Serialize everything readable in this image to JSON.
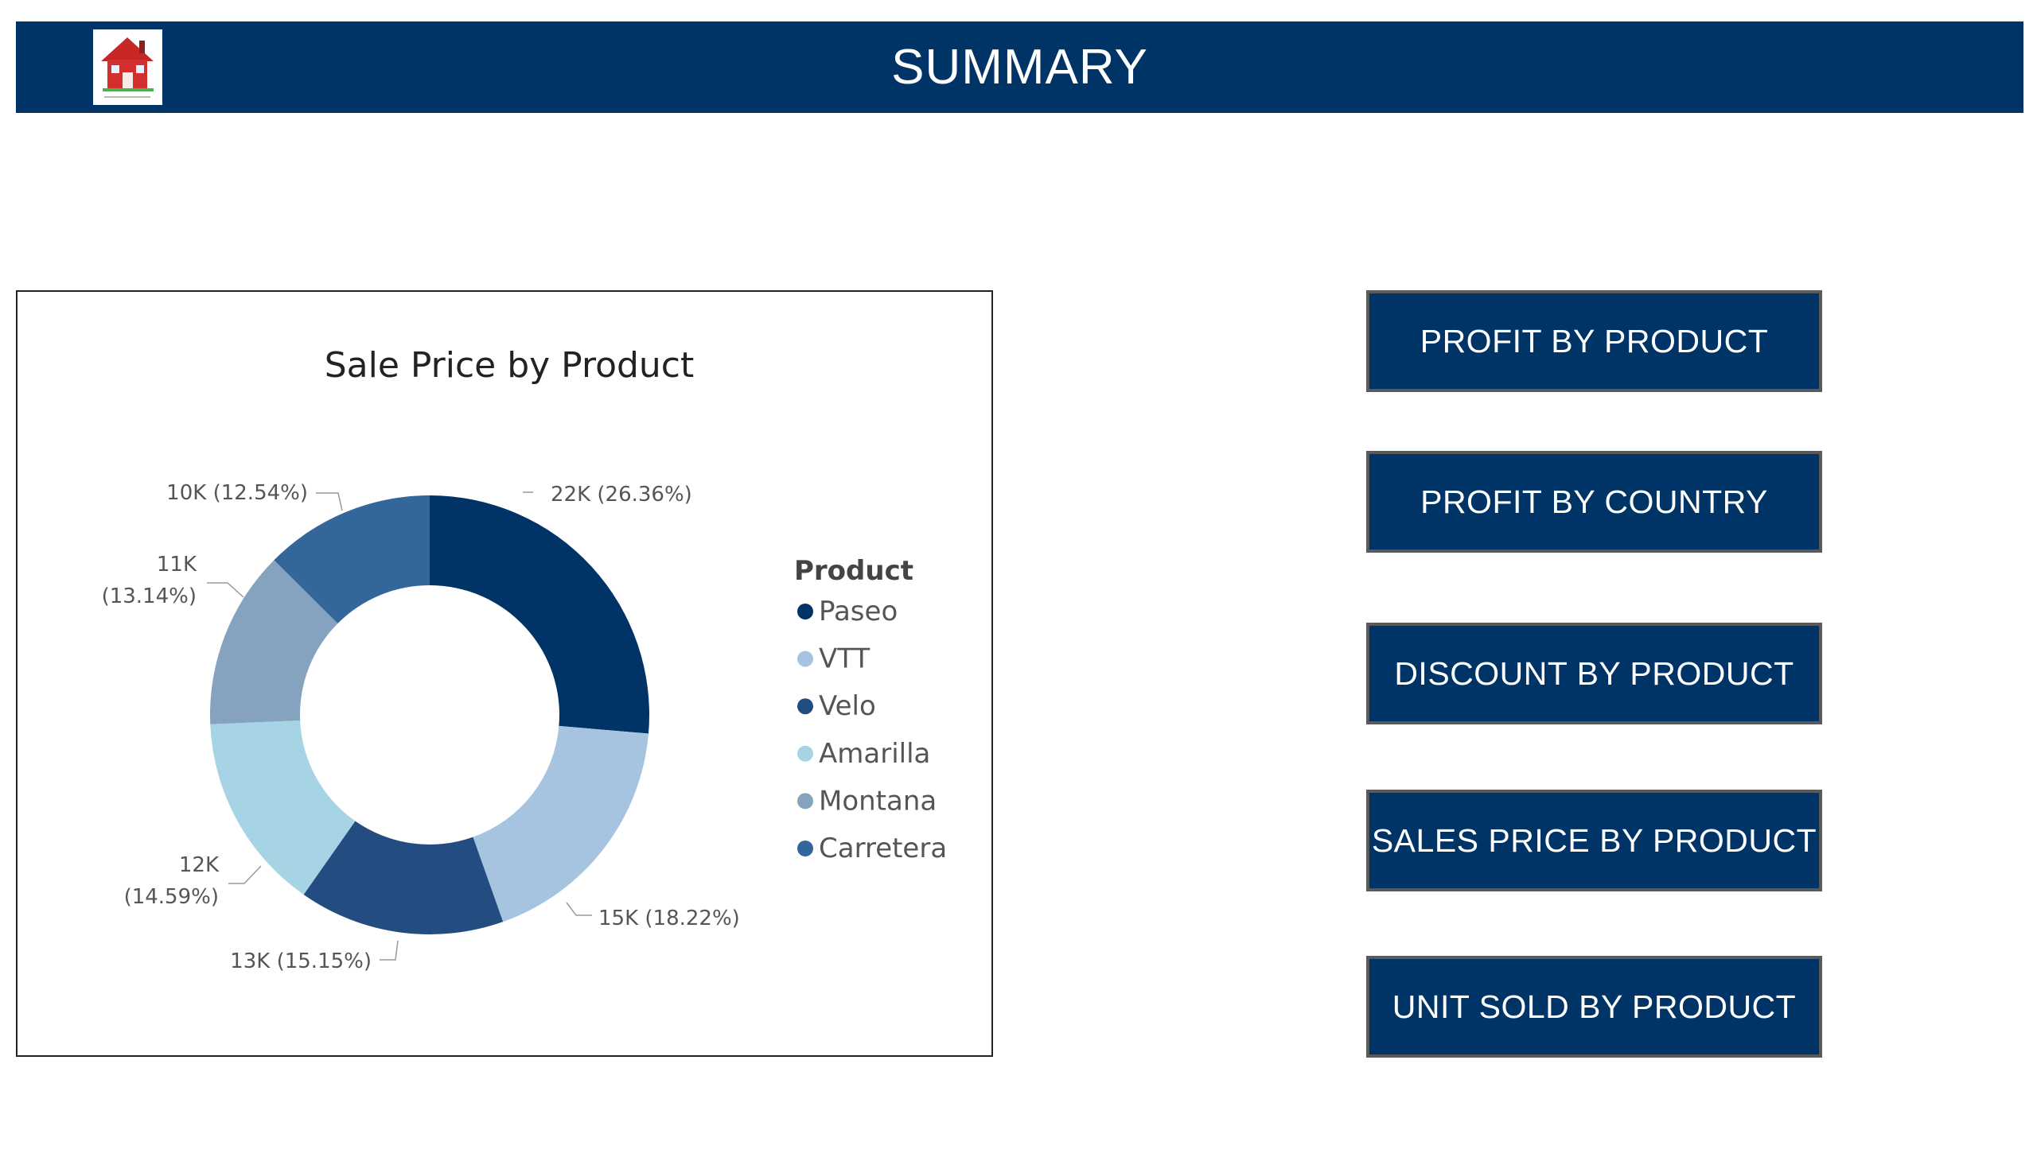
{
  "header": {
    "title": "SUMMARY",
    "logo_icon": "house-icon",
    "background": "#003366"
  },
  "nav_buttons": [
    {
      "label": "PROFIT BY PRODUCT"
    },
    {
      "label": "PROFIT BY COUNTRY"
    },
    {
      "label": "DISCOUNT BY PRODUCT"
    },
    {
      "label": "SALES PRICE BY PRODUCT"
    },
    {
      "label": "UNIT SOLD BY PRODUCT"
    }
  ],
  "chart_data": {
    "type": "pie",
    "variant": "donut",
    "title": "Sale Price by Product",
    "legend_title": "Product",
    "legend_position": "right",
    "series": [
      {
        "name": "Paseo",
        "value": 22,
        "label": "22K (26.36%)",
        "percent": 26.36,
        "color": "#003366"
      },
      {
        "name": "VTT",
        "value": 15,
        "label": "15K (18.22%)",
        "percent": 18.22,
        "color": "#a6c4e0"
      },
      {
        "name": "Velo",
        "value": 13,
        "label": "13K (15.15%)",
        "percent": 15.15,
        "color": "#234d80"
      },
      {
        "name": "Amarilla",
        "value": 12,
        "label": "12K (14.59%)",
        "percent": 14.59,
        "color": "#a6d4e4"
      },
      {
        "name": "Montana",
        "value": 11,
        "label": "11K (13.14%)",
        "percent": 13.14,
        "color": "#85a3bf"
      },
      {
        "name": "Carretera",
        "value": 10,
        "label": "10K (12.54%)",
        "percent": 12.54,
        "color": "#33669a"
      }
    ]
  }
}
